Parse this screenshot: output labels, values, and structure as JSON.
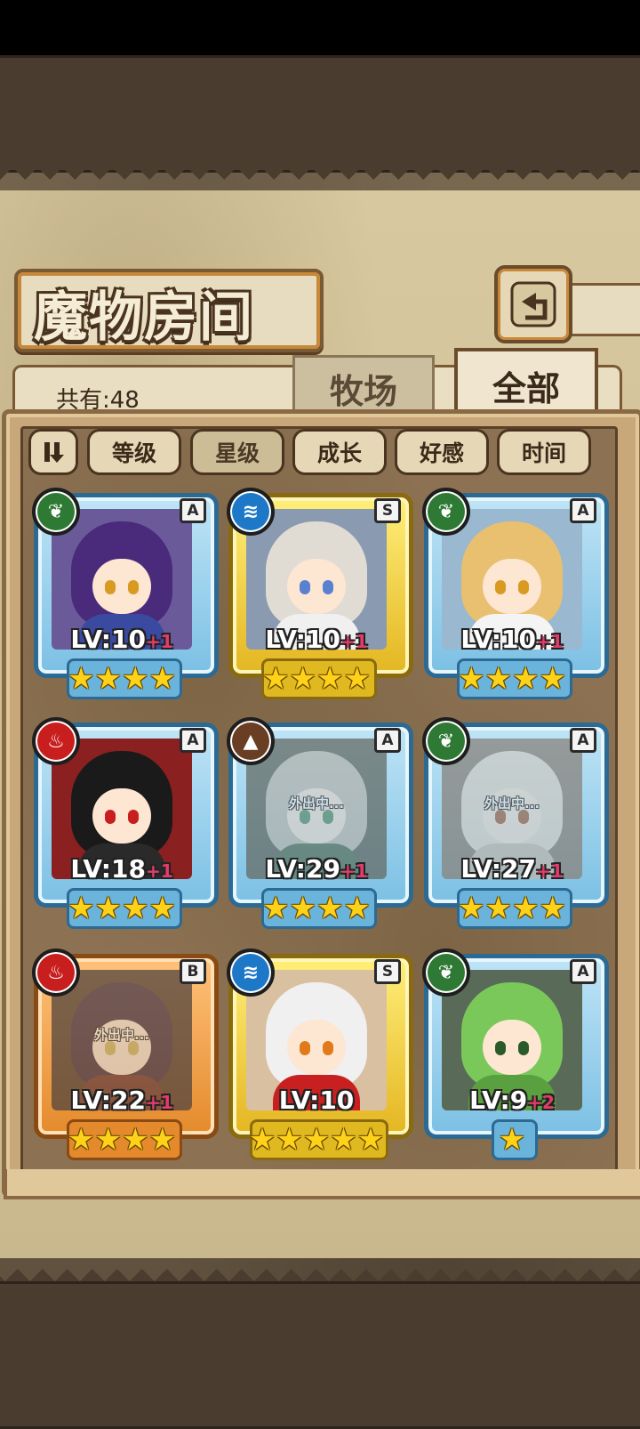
{
  "title": "魔物房间",
  "count_label": "共有:48",
  "tabs": {
    "ranch": "牧场",
    "all": "全部"
  },
  "sort_buttons": [
    {
      "label": "等级"
    },
    {
      "label": "星级"
    },
    {
      "label": "成长"
    },
    {
      "label": "好感"
    },
    {
      "label": "时间"
    }
  ],
  "active_sort": "星级",
  "away_label": "外出中...",
  "monsters": [
    {
      "element": "nature",
      "rank": "A",
      "level": "LV:10",
      "bonus": "+1",
      "stars": 4,
      "away": false
    },
    {
      "element": "water",
      "rank": "S",
      "level": "LV:10",
      "bonus": "+1",
      "stars": 4,
      "away": false
    },
    {
      "element": "nature",
      "rank": "A",
      "level": "LV:10",
      "bonus": "+1",
      "stars": 4,
      "away": false
    },
    {
      "element": "fire",
      "rank": "A",
      "level": "LV:18",
      "bonus": "+1",
      "stars": 4,
      "away": false
    },
    {
      "element": "earth",
      "rank": "A",
      "level": "LV:29",
      "bonus": "+1",
      "stars": 4,
      "away": true
    },
    {
      "element": "nature",
      "rank": "A",
      "level": "LV:27",
      "bonus": "+1",
      "stars": 4,
      "away": true
    },
    {
      "element": "fire",
      "rank": "B",
      "level": "LV:22",
      "bonus": "+1",
      "stars": 4,
      "away": true
    },
    {
      "element": "water",
      "rank": "S",
      "level": "LV:10",
      "bonus": "",
      "stars": 5,
      "away": false
    },
    {
      "element": "nature",
      "rank": "A",
      "level": "LV:9",
      "bonus": "+2",
      "stars": 1,
      "away": false
    }
  ],
  "colors": {
    "nature": "#2e7a34",
    "water": "#1e78c8",
    "fire": "#c81e1e",
    "earth": "#6a3e22"
  },
  "icons": {
    "nature": "leaf-icon",
    "water": "water-wave-icon",
    "fire": "flame-icon",
    "earth": "mountain-icon",
    "back": "back-arrow-icon",
    "sort_toggle": "sort-order-icon"
  }
}
